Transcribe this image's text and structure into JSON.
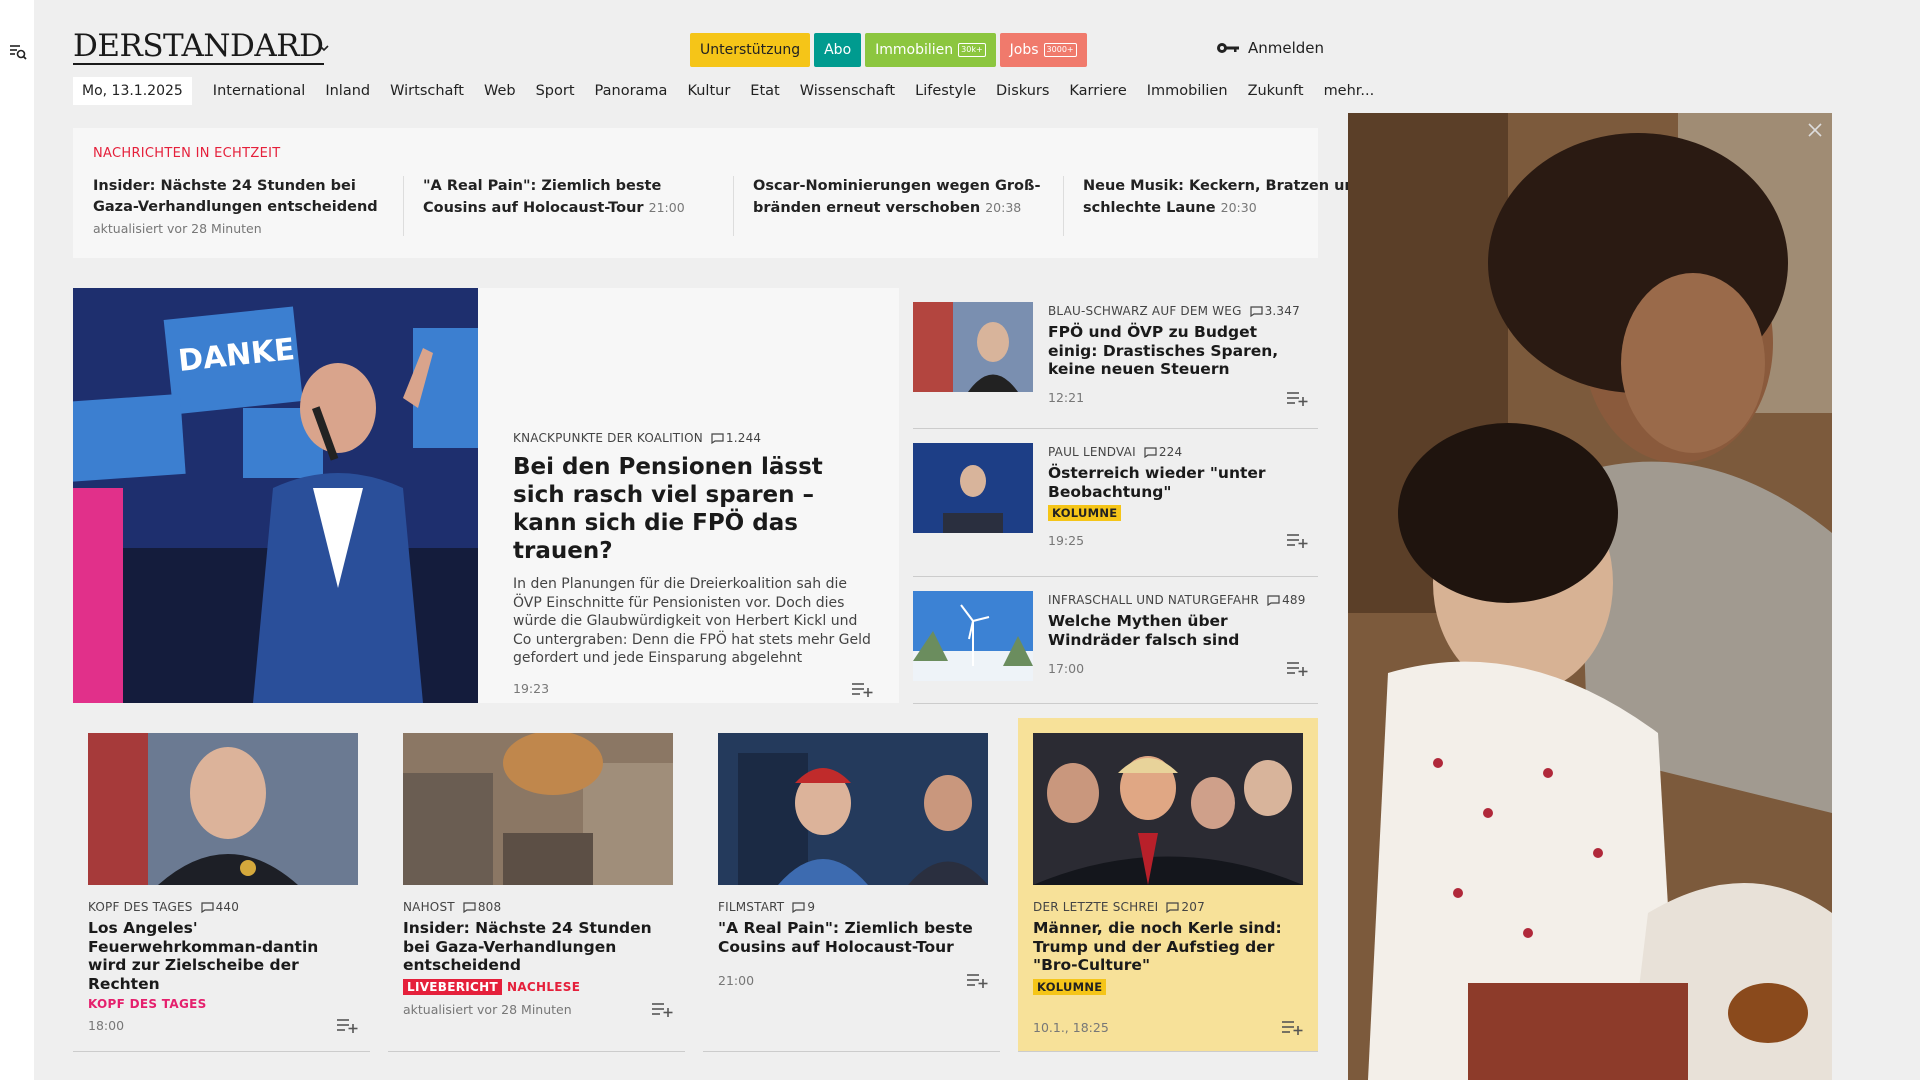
{
  "header": {
    "logo_text": "DERSTANDARD",
    "pills": [
      {
        "label": "Unterstützung"
      },
      {
        "label": "Abo"
      },
      {
        "label": "Immobilien",
        "badge": "30k+"
      },
      {
        "label": "Jobs",
        "badge": "3000+"
      }
    ],
    "login_label": "Anmelden"
  },
  "nav": {
    "date": "Mo, 13.1.2025",
    "items": [
      "International",
      "Inland",
      "Wirtschaft",
      "Web",
      "Sport",
      "Panorama",
      "Kultur",
      "Etat",
      "Wissenschaft",
      "Lifestyle",
      "Diskurs",
      "Karriere",
      "Immobilien",
      "Zukunft",
      "mehr..."
    ]
  },
  "ticker": {
    "title": "NACHRICHTEN IN ECHTZEIT",
    "items": [
      {
        "headline": "Insider: Nächste 24 Stunden bei Gaza-Verhandlungen entscheidend",
        "time": "",
        "sub": "aktualisiert vor 28 Minuten"
      },
      {
        "headline": "\"A Real Pain\": Ziemlich beste Cousins auf Holocaust-Tour",
        "time": "21:00",
        "sub": ""
      },
      {
        "headline": "Oscar-Nominierungen wegen Groß-bränden erneut verschoben",
        "time": "20:38",
        "sub": ""
      },
      {
        "headline": "Neue Musik: Keckern, Bratzen und schlechte Laune",
        "time": "20:30",
        "sub": ""
      }
    ]
  },
  "lead": {
    "kicker": "KNACKPUNKTE DER KOALITION",
    "comments": "1.244",
    "headline": "Bei den Pensionen lässt sich rasch viel sparen – kann sich die FPÖ das trauen?",
    "teaser": "In den Planungen für die Dreierkoalition sah die ÖVP Einschnitte für Pensionisten vor. Doch dies würde die Glaubwürdigkeit von Herbert Kickl und Co untergraben: Denn die FPÖ hat stets mehr Geld gefordert und jede Einsparung abgelehnt",
    "time": "19:23",
    "image_text": "DANKE"
  },
  "side": [
    {
      "kicker": "BLAU-SCHWARZ AUF DEM WEG",
      "comments": "3.347",
      "headline": "FPÖ und ÖVP zu Budget einig: Drastisches Sparen, keine neuen Steuern",
      "tag": "",
      "time": "12:21"
    },
    {
      "kicker": "PAUL LENDVAI",
      "comments": "224",
      "headline": "Österreich wieder \"unter Beobachtung\"",
      "tag": "KOLUMNE",
      "time": "19:25"
    },
    {
      "kicker": "INFRASCHALL UND NATURGEFAHR",
      "comments": "489",
      "headline": "Welche Mythen über Windräder falsch sind",
      "tag": "",
      "time": "17:00"
    }
  ],
  "cards": [
    {
      "kicker": "KOPF DES TAGES",
      "comments": "440",
      "headline": "Los Angeles' Feuerwehrkomman-dantin wird zur Zielscheibe der Rechten",
      "tag": "KOPF DES TAGES",
      "time": "18:00"
    },
    {
      "kicker": "NAHOST",
      "comments": "808",
      "headline": "Insider: Nächste 24 Stunden bei Gaza-Verhandlungen entscheidend",
      "tag_live": "LIVEBERICHT",
      "tag_nach": "NACHLESE",
      "time": "aktualisiert vor 28 Minuten"
    },
    {
      "kicker": "FILMSTART",
      "comments": "9",
      "headline": "\"A Real Pain\": Ziemlich beste Cousins auf Holocaust-Tour",
      "time": "21:00"
    },
    {
      "kicker": "DER LETZTE SCHREI",
      "comments": "207",
      "headline": "Männer, die noch Kerle sind: Trump und der Aufstieg der \"Bro-Culture\"",
      "tag": "KOLUMNE",
      "time": "10.1., 18:25"
    }
  ],
  "colors": {
    "accent_red": "#e5203b",
    "highlight_yellow": "#f5c518",
    "abo_teal": "#009b8f",
    "immo_green": "#8cc63f",
    "jobs_coral": "#f07a6c",
    "pink": "#e5206d"
  }
}
